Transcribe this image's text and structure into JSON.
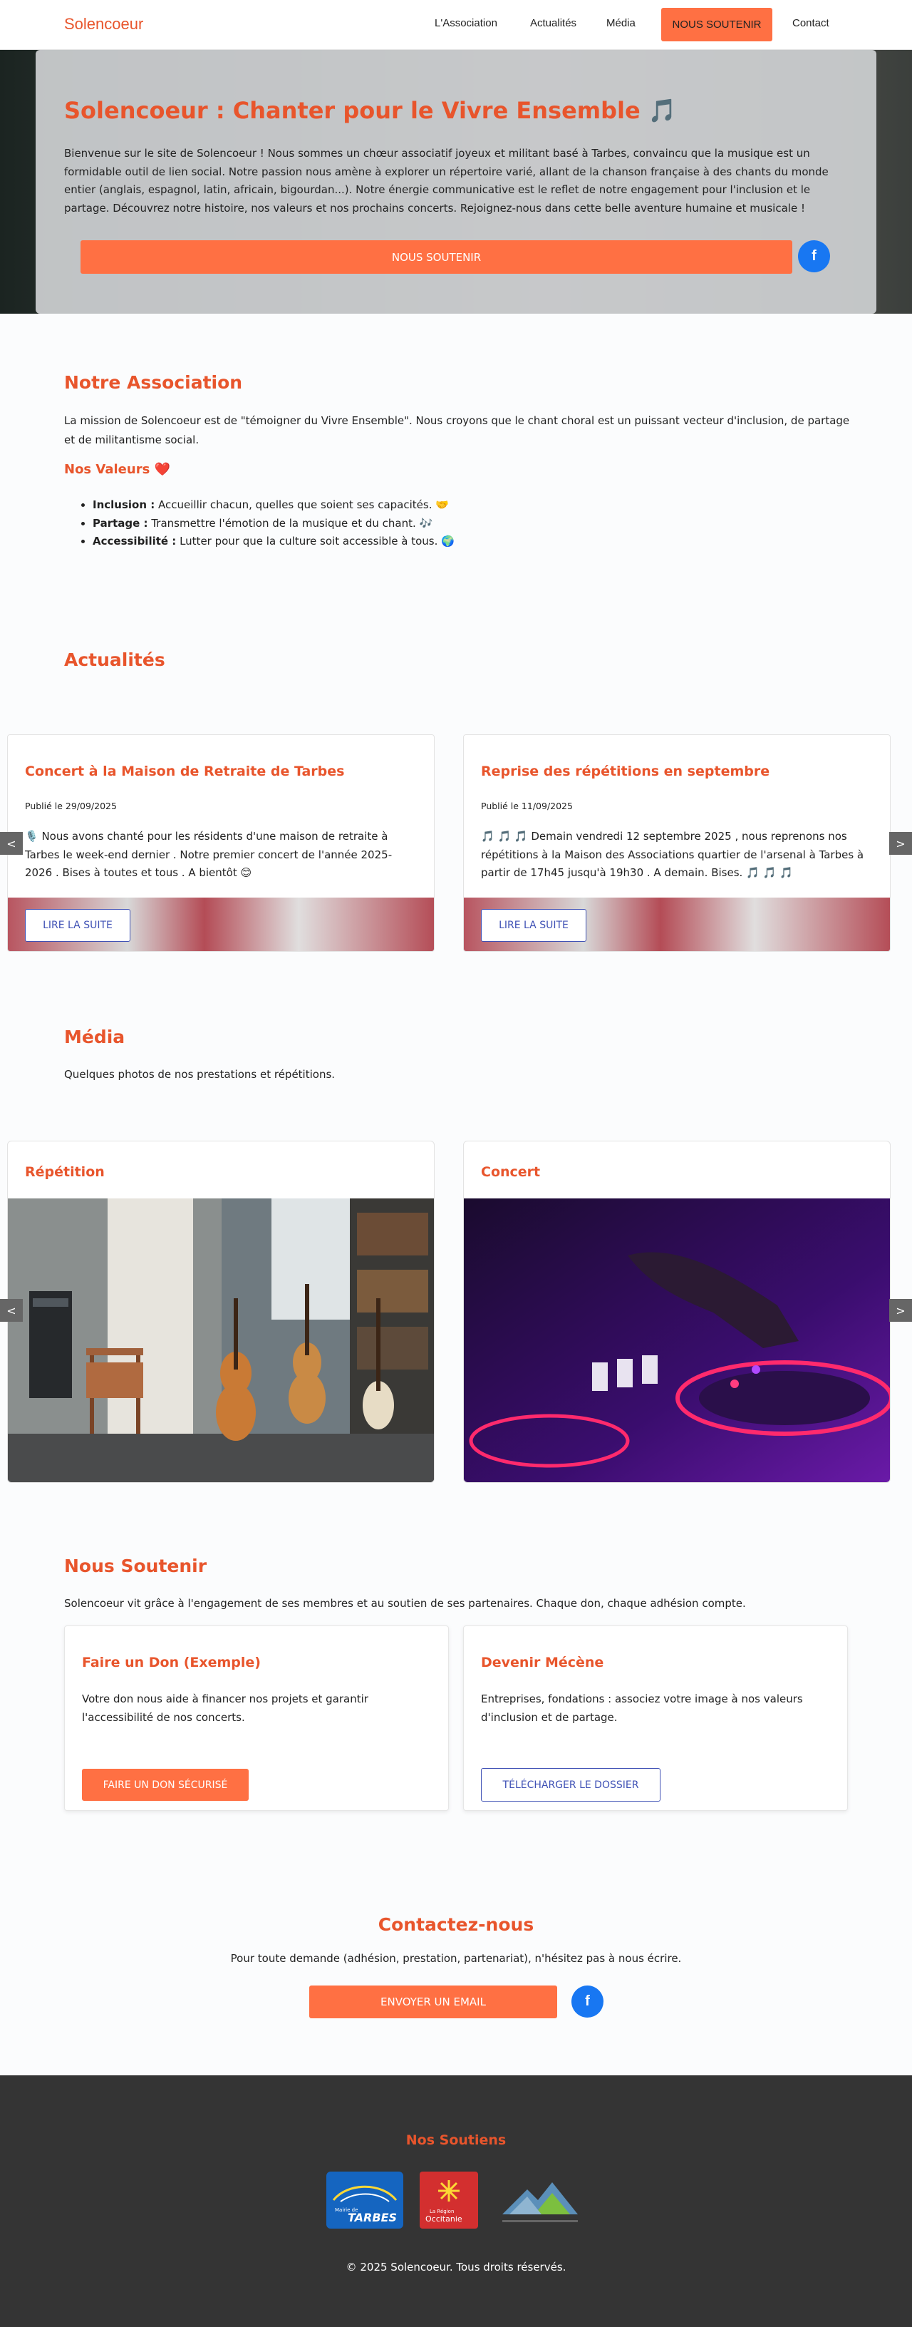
{
  "header": {
    "logo": "Solencoeur",
    "nav": [
      "L'Association",
      "Actualités",
      "Média",
      "NOUS SOUTENIR",
      "Contact"
    ]
  },
  "hero": {
    "title": "Solencoeur : Chanter pour le Vivre Ensemble 🎵",
    "text": "Bienvenue sur le site de Solencoeur ! Nous sommes un chœur associatif joyeux et militant basé à Tarbes, convaincu que la musique est un formidable outil de lien social. Notre passion nous amène à explorer un répertoire varié, allant de la chanson française à des chants du monde entier (anglais, espagnol, latin, africain, bigourdan...). Notre énergie communicative est le reflet de notre engagement pour l'inclusion et le partage. Découvrez notre histoire, nos valeurs et nos prochains concerts. Rejoignez-nous dans cette belle aventure humaine et musicale !",
    "button": "NOUS SOUTENIR",
    "facebook_icon": "facebook-icon"
  },
  "association": {
    "title": "Notre Association",
    "text": "La mission de Solencoeur est de \"témoigner du Vivre Ensemble\". Nous croyons que le chant choral est un puissant vecteur d'inclusion, de partage et de militantisme social.",
    "values_title": "Nos Valeurs ❤️",
    "values": [
      {
        "label": "Inclusion :",
        "text": "Accueillir chacun, quelles que soient ses capacités. 🤝"
      },
      {
        "label": "Partage :",
        "text": "Transmettre l'émotion de la musique et du chant. 🎶"
      },
      {
        "label": "Accessibilité :",
        "text": "Lutter pour que la culture soit accessible à tous. 🌍"
      }
    ]
  },
  "news": {
    "title": "Actualités",
    "prev": "<",
    "next": ">",
    "items": [
      {
        "title": "Concert à la Maison de Retraite de Tarbes",
        "date": "Publié le 29/09/2025",
        "text": "🎙️ Nous avons chanté pour les résidents d'une maison de retraite à Tarbes le week-end dernier . Notre premier concert de l'année 2025-2026 . Bises à toutes et tous . A bientôt 😊",
        "button": "LIRE LA SUITE"
      },
      {
        "title": "Reprise des répétitions en septembre",
        "date": "Publié le 11/09/2025",
        "text": "🎵 🎵 🎵 Demain vendredi 12 septembre 2025 , nous reprenons nos répétitions à la Maison des Associations quartier de l'arsenal à Tarbes à partir de 17h45 jusqu'à 19h30 . A demain. Bises. 🎵 🎵 🎵",
        "button": "LIRE LA SUITE"
      }
    ]
  },
  "media": {
    "title": "Média",
    "text": "Quelques photos de nos prestations et répétitions.",
    "prev": "<",
    "next": ">",
    "items": [
      {
        "title": "Répétition"
      },
      {
        "title": "Concert"
      }
    ]
  },
  "support": {
    "title": "Nous Soutenir",
    "text": "Solencoeur vit grâce à l'engagement de ses membres et au soutien de ses partenaires. Chaque don, chaque adhésion compte.",
    "don": {
      "title": "Faire un Don (Exemple)",
      "text": "Votre don nous aide à financer nos projets et garantir l'accessibilité de nos concerts.",
      "button": "FAIRE UN DON SÉCURISÉ"
    },
    "mecene": {
      "title": "Devenir Mécène",
      "text": "Entreprises, fondations : associez votre image à nos valeurs d'inclusion et de partage.",
      "button": "TÉLÉCHARGER LE DOSSIER"
    }
  },
  "contact": {
    "title": "Contactez-nous",
    "text": "Pour toute demande (adhésion, prestation, partenariat), n'hésitez pas à nous écrire.",
    "button": "ENVOYER UN EMAIL"
  },
  "footer": {
    "title": "Nos Soutiens",
    "logos": {
      "tarbes_small": "Mairie de",
      "tarbes": "TARBES",
      "occitanie_small": "La Région",
      "occitanie": "Occitanie"
    },
    "copyright": "© 2025 Solencoeur. Tous droits réservés."
  },
  "colors": {
    "accent": "#e8552c",
    "button": "#ff7043",
    "link_blue": "#3f51b5",
    "facebook": "#1877f2",
    "footer_bg": "#343434"
  }
}
